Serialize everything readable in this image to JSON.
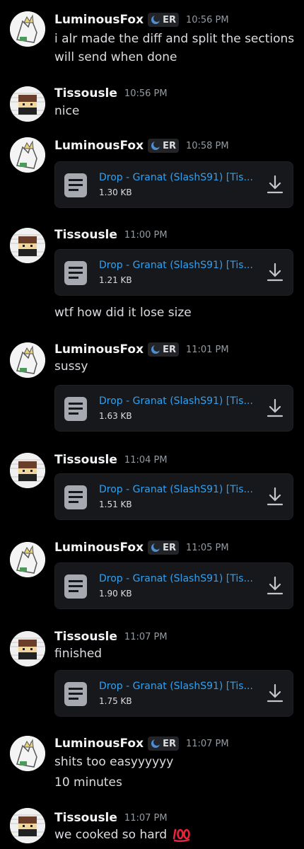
{
  "users": {
    "fox": {
      "name": "LuminousFox",
      "tag": "ER"
    },
    "tiss": {
      "name": "Tissousle"
    }
  },
  "messages": [
    {
      "time": "10:56 PM",
      "lines": [
        "i alr made the diff and split the sections",
        "will send when done"
      ]
    },
    {
      "time": "10:56 PM",
      "lines": [
        "nice"
      ]
    },
    {
      "time": "10:58 PM",
      "file": {
        "name": "Drop - Granat (SlashS91) [Tis...",
        "size": "1.30 KB"
      }
    },
    {
      "time": "11:00 PM",
      "file": {
        "name": "Drop - Granat (SlashS91) [Tis...",
        "size": "1.21 KB"
      },
      "after": "wtf how did it lose size"
    },
    {
      "time": "11:01 PM",
      "lines": [
        "sussy"
      ],
      "file": {
        "name": "Drop - Granat (SlashS91) [Tis...",
        "size": "1.63 KB"
      }
    },
    {
      "time": "11:04 PM",
      "file": {
        "name": "Drop - Granat (SlashS91) [Tis...",
        "size": "1.51 KB"
      }
    },
    {
      "time": "11:05 PM",
      "file": {
        "name": "Drop - Granat (SlashS91) [Tis...",
        "size": "1.90 KB"
      }
    },
    {
      "time": "11:07 PM",
      "lines": [
        "finished"
      ],
      "file": {
        "name": "Drop - Granat (SlashS91) [Tis...",
        "size": "1.75 KB"
      }
    },
    {
      "time": "11:07 PM",
      "lines": [
        "shits too easyyyyyy",
        "10 minutes"
      ]
    },
    {
      "time": "11:07 PM",
      "lines": [
        "we cooked so hard"
      ],
      "emoji": "hundred-points-emoji"
    }
  ],
  "colors": {
    "background": "#000000",
    "link": "#32a0f0",
    "timestamp": "#949ba4",
    "card": "#17181b"
  },
  "icons": {
    "file": "file-text-icon",
    "download": "download-icon",
    "tag": "moon-tag-icon"
  }
}
